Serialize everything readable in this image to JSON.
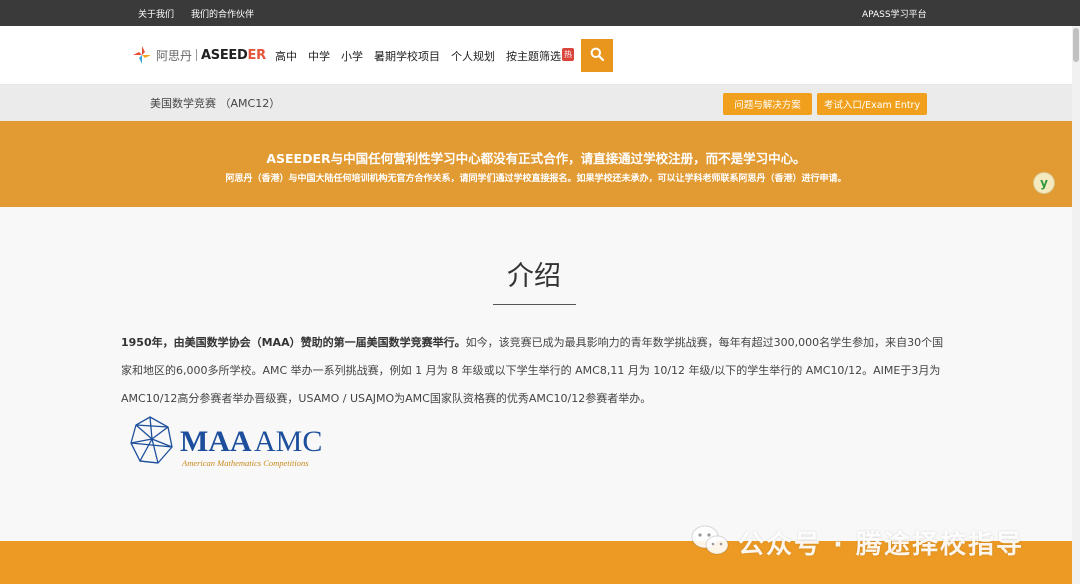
{
  "topbar": {
    "about": "关于我们",
    "partners": "我们的合作伙伴",
    "platform": "APASS学习平台"
  },
  "logo": {
    "cn": "阿思丹",
    "en_prefix": "ASEED",
    "en_suffix": "ER"
  },
  "nav": {
    "items": [
      "高中",
      "中学",
      "小学",
      "暑期学校项目",
      "个人规划",
      "按主题筛选"
    ],
    "hot_badge": "热",
    "search_icon": "search-icon"
  },
  "subbar": {
    "title": "美国数学竞赛 （AMC12）",
    "btn_faq": "问题与解决方案",
    "btn_exam": "考试入口/Exam Entry"
  },
  "notice": {
    "line1": "ASEEDER与中国任何营利性学习中心都没有正式合作，请直接通过学校注册，而不是学习中心。",
    "line2": "阿思丹（香港）与中国大陆任何培训机构无官方合作关系，请同学们通过学校直接报名。如果学校还未承办，可以让学科老师联系阿思丹（香港）进行申请。"
  },
  "main": {
    "heading": "介绍",
    "para_bold": "1950年，由美国数学协会（MAA）赞助的第一届美国数学竞赛举行。",
    "para_rest": "如今，该竞赛已成为最具影响力的青年数学挑战赛，每年有超过300,000名学生参加，来自30个国家和地区的6,000多所学校。AMC 举办一系列挑战赛，例如 1 月为 8 年级或以下学生举行的 AMC8,11 月为 10/12 年级/以下的学生举行的 AMC10/12。AIME于3月为AMC10/12高分参赛者举办晋级赛，USAMO / USAJMO为AMC国家队资格赛的优秀AMC10/12参赛者举办。",
    "amc_logo_maa": "MAA",
    "amc_logo_amc": "AMC",
    "amc_logo_sub": "American Mathematics Competitions"
  },
  "watermark": {
    "text": "公众号 · 腾途择校指导"
  },
  "colors": {
    "accent": "#e8961e",
    "notice_bg": "#e29a32",
    "topbar_bg": "#3a3a3a",
    "amc_blue": "#1d4f9c"
  }
}
